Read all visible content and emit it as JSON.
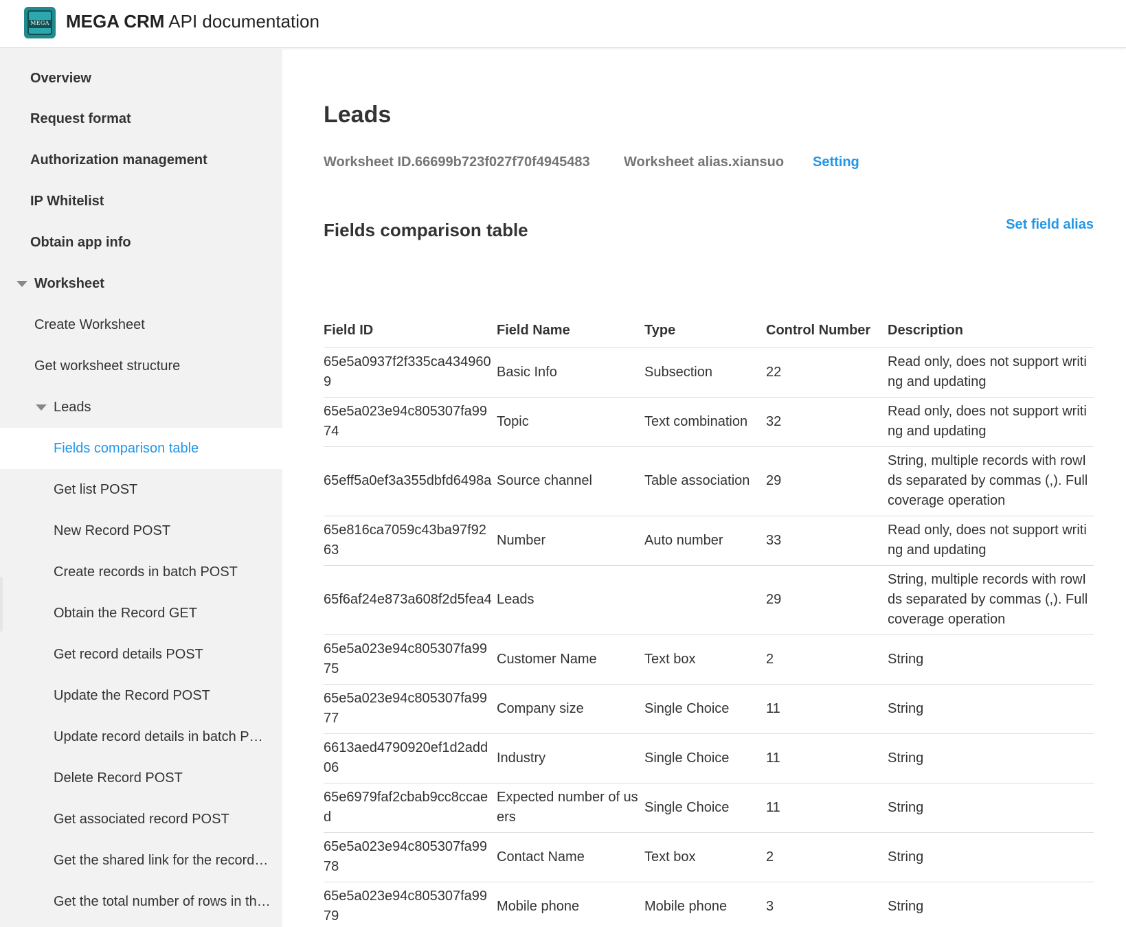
{
  "header": {
    "logo_text": "MEGA",
    "title_bold": "MEGA CRM",
    "title_rest": " API documentation"
  },
  "sidebar": {
    "items": [
      {
        "label": "Overview"
      },
      {
        "label": "Request format"
      },
      {
        "label": "Authorization management"
      },
      {
        "label": "IP Whitelist"
      },
      {
        "label": "Obtain app info"
      },
      {
        "label": "Worksheet"
      },
      {
        "label": "Create Worksheet"
      },
      {
        "label": "Get worksheet structure"
      },
      {
        "label": "Leads"
      },
      {
        "label": "Fields comparison table"
      },
      {
        "label": "Get list POST"
      },
      {
        "label": "New Record POST"
      },
      {
        "label": "Create records in batch POST"
      },
      {
        "label": "Obtain the Record GET"
      },
      {
        "label": "Get record details POST"
      },
      {
        "label": "Update the Record POST"
      },
      {
        "label": "Update record details in batch P…"
      },
      {
        "label": "Delete Record POST"
      },
      {
        "label": "Get associated record POST"
      },
      {
        "label": "Get the shared link for the record…"
      },
      {
        "label": "Get the total number of rows in th…"
      }
    ]
  },
  "main": {
    "title": "Leads",
    "worksheet_id": "Worksheet ID.66699b723f027f70f4945483",
    "worksheet_alias": "Worksheet alias.xiansuo",
    "setting_label": "Setting",
    "section_title": "Fields comparison table",
    "set_alias_label": "Set field alias",
    "table": {
      "headers": [
        "Field ID",
        "Field Name",
        "Type",
        "Control Number",
        "Description"
      ],
      "rows": [
        [
          "65e5a0937f2f335ca4349609",
          "Basic Info",
          "Subsection",
          "22",
          "Read only, does not support writing and updating"
        ],
        [
          "65e5a023e94c805307fa9974",
          "Topic",
          "Text combination",
          "32",
          "Read only, does not support writing and updating"
        ],
        [
          "65eff5a0ef3a355dbfd6498a",
          "Source channel",
          "Table association",
          "29",
          "String, multiple records with rowIds separated by commas (,). Full coverage operation"
        ],
        [
          "65e816ca7059c43ba97f9263",
          "Number",
          "Auto number",
          "33",
          "Read only, does not support writing and updating"
        ],
        [
          "65f6af24e873a608f2d5fea4",
          "Leads",
          "",
          "29",
          "String, multiple records with rowIds separated by commas (,). Full coverage operation"
        ],
        [
          "65e5a023e94c805307fa9975",
          "Customer Name",
          "Text box",
          "2",
          "String"
        ],
        [
          "65e5a023e94c805307fa9977",
          "Company size",
          "Single Choice",
          "11",
          "String"
        ],
        [
          "6613aed4790920ef1d2add06",
          "Industry",
          "Single Choice",
          "11",
          "String"
        ],
        [
          "65e6979faf2cbab9cc8ccaed",
          "Expected number of users",
          "Single Choice",
          "11",
          "String"
        ],
        [
          "65e5a023e94c805307fa9978",
          "Contact Name",
          "Text box",
          "2",
          "String"
        ],
        [
          "65e5a023e94c805307fa9979",
          "Mobile phone",
          "Mobile phone",
          "3",
          "String"
        ]
      ]
    }
  },
  "colors": {
    "accent": "#2196e8",
    "sidebar_bg": "#f2f2f2",
    "logo": "#1f8b8f"
  },
  "icons": [
    "logo-icon",
    "caret-down-icon"
  ]
}
